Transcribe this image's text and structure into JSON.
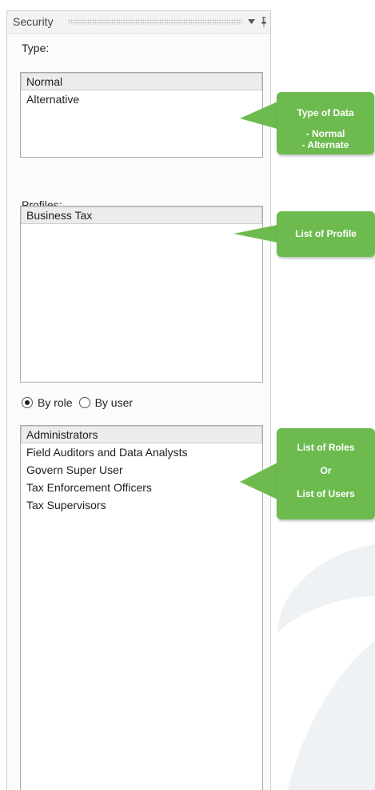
{
  "panel": {
    "title": "Security",
    "dropdown_icon": "dropdown-arrow-icon",
    "pin_icon": "pin-icon"
  },
  "type_section": {
    "label": "Type:",
    "items": [
      "Normal",
      "Alternative"
    ],
    "selected": "Normal"
  },
  "profiles_section": {
    "label": "Profiles:",
    "items": [
      "Business Tax"
    ],
    "selected": "Business Tax"
  },
  "view_mode": {
    "by_role_label": "By role",
    "by_user_label": "By user",
    "selected": "By role"
  },
  "roles_section": {
    "items": [
      "Administrators",
      "Field Auditors and Data Analysts",
      "Govern Super User",
      "Tax Enforcement Officers",
      "Tax Supervisors"
    ],
    "selected": "Administrators"
  },
  "callouts": {
    "type": {
      "line1": "Type of Data",
      "line2": "- Normal",
      "line3": "- Alternate"
    },
    "profiles": {
      "line1": "List of Profile"
    },
    "roles": {
      "line1": "List of Roles",
      "line2": "Or",
      "line3": "List of Users"
    }
  },
  "colors": {
    "callout_green": "#6dbb4f",
    "selected_item_bg": "#ececec",
    "panel_bg": "#fbfbfb"
  }
}
